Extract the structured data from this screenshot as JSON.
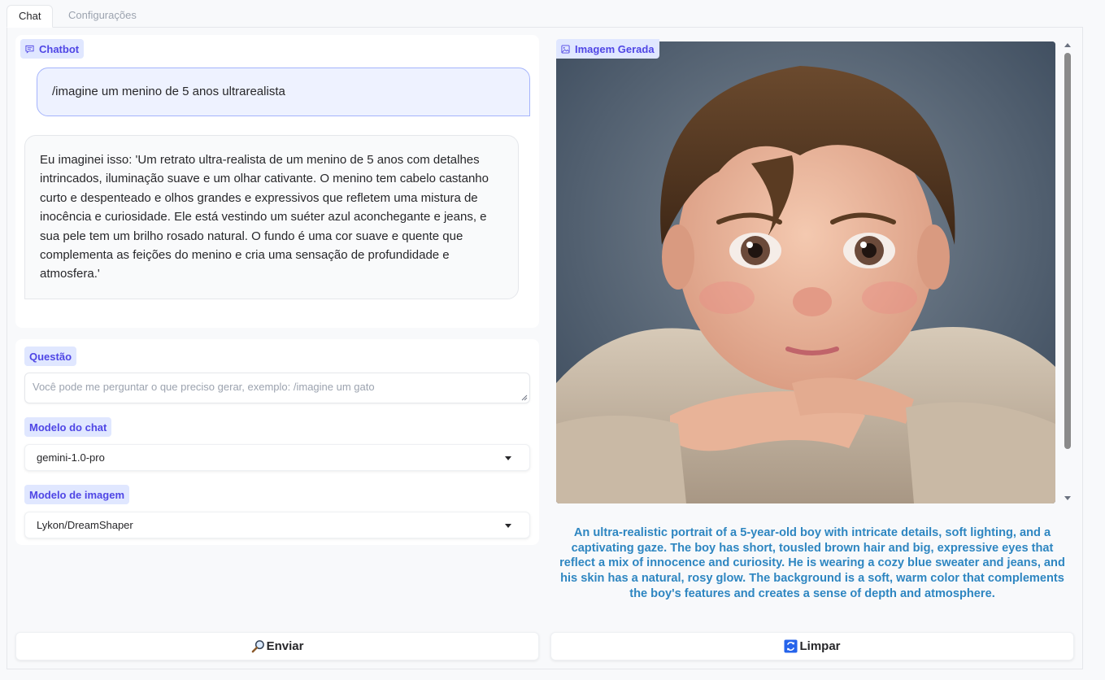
{
  "tabs": [
    {
      "label": "Chat",
      "active": true
    },
    {
      "label": "Configurações",
      "active": false
    }
  ],
  "chatbot": {
    "label": "Chatbot",
    "messages": [
      {
        "role": "user",
        "text": "/imagine um menino de 5 anos ultrarealista"
      },
      {
        "role": "bot",
        "text": "Eu imaginei isso: 'Um retrato ultra-realista de um menino de 5 anos com detalhes intrincados, iluminação suave e um olhar cativante. O menino tem cabelo castanho curto e despenteado e olhos grandes e expressivos que refletem uma mistura de inocência e curiosidade. Ele está vestindo um suéter azul aconchegante e jeans, e sua pele tem um brilho rosado natural. O fundo é uma cor suave e quente que complementa as feições do menino e cria uma sensação de profundidade e atmosfera.'"
      }
    ]
  },
  "question": {
    "label": "Questão",
    "placeholder": "Você pode me perguntar o que preciso gerar, exemplo: /imagine um gato",
    "value": ""
  },
  "chat_model": {
    "label": "Modelo do chat",
    "selected": "gemini-1.0-pro"
  },
  "image_model": {
    "label": "Modelo de imagem",
    "selected": "Lykon/DreamShaper"
  },
  "generated_image": {
    "label": "Imagem Gerada",
    "caption": "An ultra-realistic portrait of a 5-year-old boy with intricate details, soft lighting, and a captivating gaze. The boy has short, tousled brown hair and big, expressive eyes that reflect a mix of innocence and curiosity. He is wearing a cozy blue sweater and jeans, and his skin has a natural, rosy glow. The background is a soft, warm color that complements the boy's features and creates a sense of depth and atmosphere."
  },
  "buttons": {
    "send_label": "Enviar",
    "clear_label": "Limpar"
  },
  "colors": {
    "accent": "#4f46e5",
    "label_bg": "#e0e7ff",
    "caption": "#2e86c1"
  },
  "icons": {
    "chatbot": "chat-icon",
    "image": "image-icon",
    "send": "magnifier-icon",
    "clear": "refresh-icon"
  }
}
